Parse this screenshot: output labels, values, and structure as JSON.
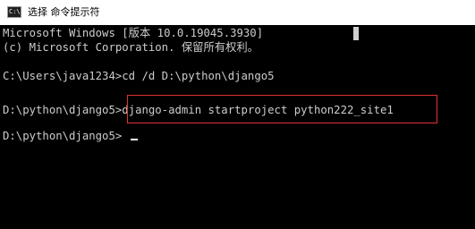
{
  "window": {
    "icon": "terminal-icon",
    "icon_glyph": "C:\\",
    "title": "选择 命令提示符"
  },
  "console": {
    "lines": [
      "Microsoft Windows [版本 10.0.19045.3930]",
      "(c) Microsoft Corporation. 保留所有权利。",
      "",
      "C:\\Users\\java1234>cd /d D:\\python\\django5",
      "",
      "D:\\python\\django5>django-admin startproject python222_site1",
      "",
      "D:\\python\\django5>"
    ],
    "highlight_color": "#e0322f"
  }
}
